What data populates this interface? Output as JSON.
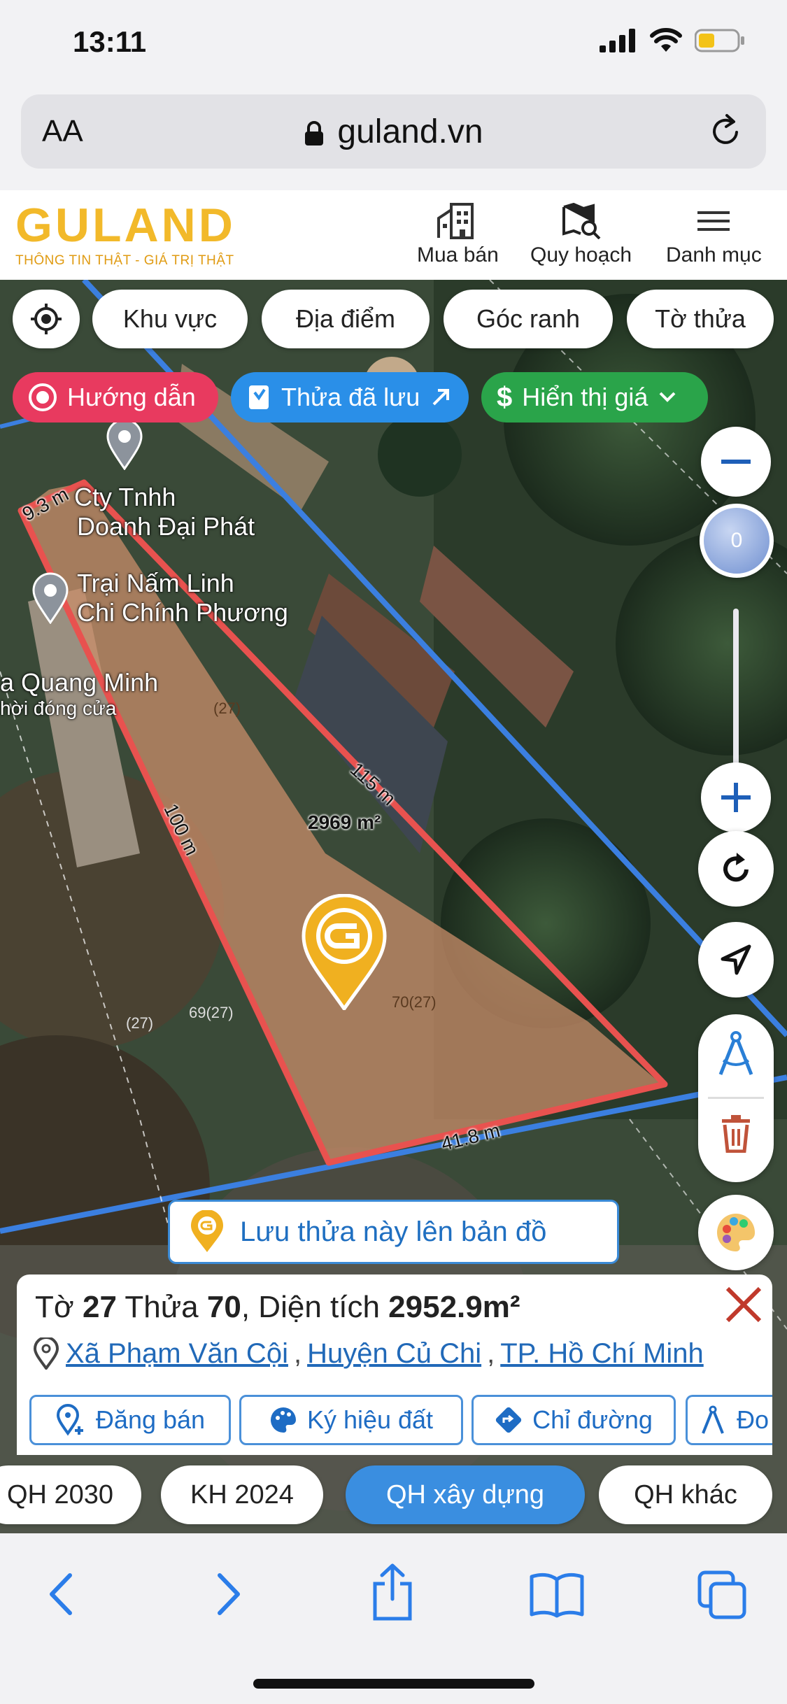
{
  "status": {
    "time": "13:11"
  },
  "browser": {
    "text_size": "AA",
    "url": "guland.vn"
  },
  "header": {
    "logo": "GULAND",
    "tagline": "THÔNG TIN THẬT - GIÁ TRỊ THẬT",
    "nav": [
      {
        "label": "Mua bán",
        "icon": "building-icon"
      },
      {
        "label": "Quy hoạch",
        "icon": "map-search-icon"
      },
      {
        "label": "Danh mục",
        "icon": "menu-icon"
      }
    ]
  },
  "map": {
    "filters": [
      "Khu vực",
      "Địa điểm",
      "Góc ranh",
      "Tờ thửa"
    ],
    "pills": {
      "guide": "Hướng dẫn",
      "saved": "Thửa đã lưu",
      "price": "Hiển thị giá"
    },
    "places": [
      "Cty Tnhh",
      "Doanh Đại Phát",
      "Trại Nấm Linh",
      "Chi Chính Phương",
      "a Quang Minh",
      "hời đóng cửa"
    ],
    "dimensions": {
      "top": "9.3 m",
      "left": "100 m",
      "right": "115 m",
      "bottom": "41.8 m",
      "area": "2969 m²"
    },
    "plot_numbers": [
      "70(27)",
      "(27)",
      "(27)",
      "69(27)"
    ],
    "zoom_level": "0",
    "save_parcel": "Lưu thửa này lên bản đồ",
    "colors": {
      "parcel": "#e8524f",
      "boundary": "#3b7fe0",
      "brand": "#f2b92a"
    }
  },
  "parcel": {
    "sheet_label": "Tờ",
    "sheet": "27",
    "parcel_label": "Thửa",
    "parcel": "70",
    "area_label": "Diện tích",
    "area": "2952.9m²",
    "ward": "Xã Phạm Văn Cội",
    "district": "Huyện Củ Chi",
    "city": "TP. Hồ Chí Minh",
    "actions": [
      "Đăng bán",
      "Ký hiệu đất",
      "Chỉ đường",
      "Đo"
    ]
  },
  "layers": [
    "QH 2030",
    "KH 2024",
    "QH xây dựng",
    "QH khác"
  ],
  "active_layer": "QH xây dựng"
}
